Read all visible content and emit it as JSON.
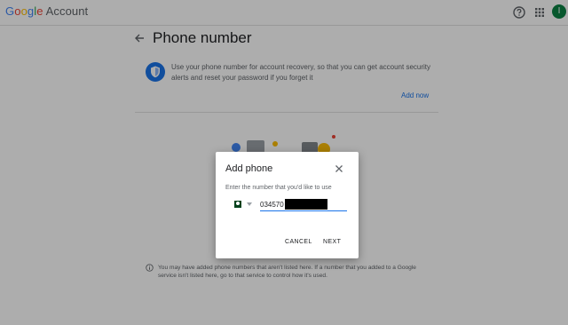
{
  "header": {
    "logo_letters": [
      "G",
      "o",
      "o",
      "g",
      "l",
      "e"
    ],
    "logo_suffix": "Account",
    "avatar_initial": "I"
  },
  "page": {
    "title": "Phone number",
    "info_text": "Use your phone number for account recovery, so that you can get account security alerts and reset your password if you forget it",
    "add_now_label": "Add now",
    "note_text": "You may have added phone numbers that aren't listed here. If a number that you added to a Google service isn't listed here, go to that service to control how it's used."
  },
  "dialog": {
    "title": "Add phone",
    "label": "Enter the number that you'd like to use",
    "phone_value": "034570",
    "cancel_label": "CANCEL",
    "next_label": "NEXT"
  },
  "colors": {
    "accent": "#1a73e8",
    "overlay": "rgba(0,0,0,0.32)",
    "avatar": "#0b8043"
  }
}
